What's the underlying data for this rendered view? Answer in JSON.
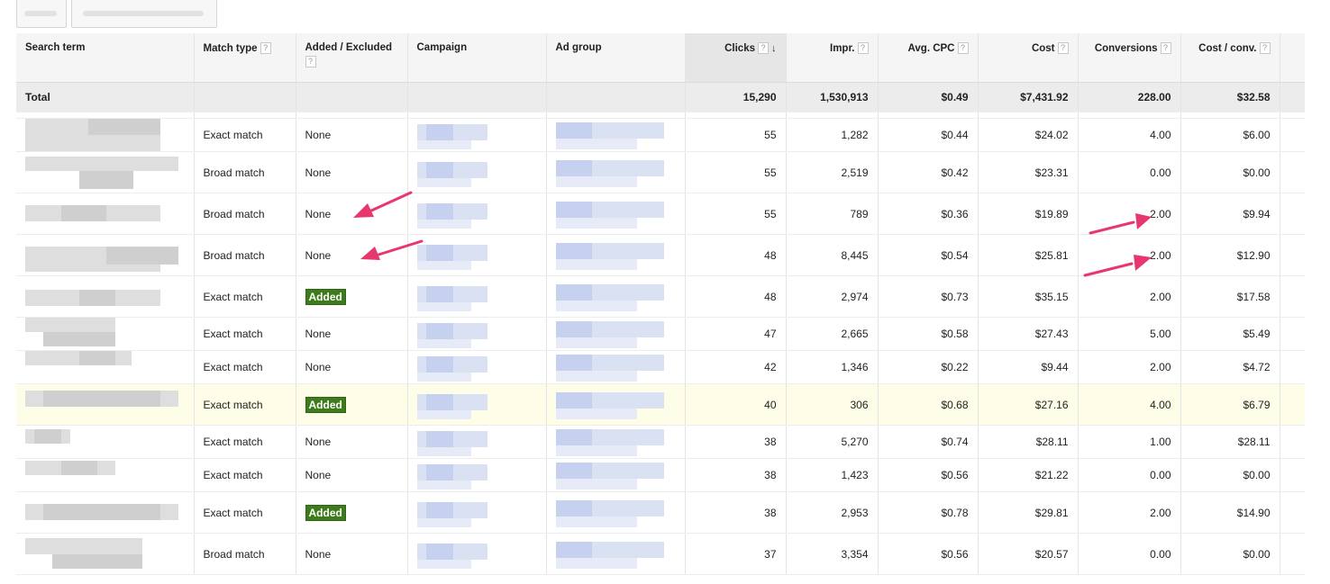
{
  "toolbar": {
    "buttons": [
      {
        "label": ""
      },
      {
        "label": ""
      }
    ]
  },
  "columns": {
    "search_term": "Search term",
    "match_type": "Match type",
    "added_excluded": "Added / Excluded",
    "campaign": "Campaign",
    "ad_group": "Ad group",
    "clicks": "Clicks",
    "impr": "Impr.",
    "avg_cpc": "Avg. CPC",
    "cost": "Cost",
    "conversions": "Conversions",
    "cost_conv": "Cost / conv.",
    "help_glyph": "?",
    "sort_glyph": "↓"
  },
  "total": {
    "label": "Total",
    "clicks": "15,290",
    "impr": "1,530,913",
    "avg_cpc": "$0.49",
    "cost": "$7,431.92",
    "conversions": "228.00",
    "cost_conv": "$32.58"
  },
  "rows": [
    {
      "match_type": "Exact match",
      "status": "None",
      "clicks": "55",
      "impr": "1,282",
      "avg_cpc": "$0.44",
      "cost": "$24.02",
      "conversions": "4.00",
      "cost_conv": "$6.00"
    },
    {
      "match_type": "Broad match",
      "status": "None",
      "clicks": "55",
      "impr": "2,519",
      "avg_cpc": "$0.42",
      "cost": "$23.31",
      "conversions": "0.00",
      "cost_conv": "$0.00"
    },
    {
      "match_type": "Broad match",
      "status": "None",
      "clicks": "55",
      "impr": "789",
      "avg_cpc": "$0.36",
      "cost": "$19.89",
      "conversions": "2.00",
      "cost_conv": "$9.94"
    },
    {
      "match_type": "Broad match",
      "status": "None",
      "clicks": "48",
      "impr": "8,445",
      "avg_cpc": "$0.54",
      "cost": "$25.81",
      "conversions": "2.00",
      "cost_conv": "$12.90"
    },
    {
      "match_type": "Exact match",
      "status": "Added",
      "clicks": "48",
      "impr": "2,974",
      "avg_cpc": "$0.73",
      "cost": "$35.15",
      "conversions": "2.00",
      "cost_conv": "$17.58"
    },
    {
      "match_type": "Exact match",
      "status": "None",
      "clicks": "47",
      "impr": "2,665",
      "avg_cpc": "$0.58",
      "cost": "$27.43",
      "conversions": "5.00",
      "cost_conv": "$5.49"
    },
    {
      "match_type": "Exact match",
      "status": "None",
      "clicks": "42",
      "impr": "1,346",
      "avg_cpc": "$0.22",
      "cost": "$9.44",
      "conversions": "2.00",
      "cost_conv": "$4.72"
    },
    {
      "match_type": "Exact match",
      "status": "Added",
      "clicks": "40",
      "impr": "306",
      "avg_cpc": "$0.68",
      "cost": "$27.16",
      "conversions": "4.00",
      "cost_conv": "$6.79"
    },
    {
      "match_type": "Exact match",
      "status": "None",
      "clicks": "38",
      "impr": "5,270",
      "avg_cpc": "$0.74",
      "cost": "$28.11",
      "conversions": "1.00",
      "cost_conv": "$28.11"
    },
    {
      "match_type": "Exact match",
      "status": "None",
      "clicks": "38",
      "impr": "1,423",
      "avg_cpc": "$0.56",
      "cost": "$21.22",
      "conversions": "0.00",
      "cost_conv": "$0.00"
    },
    {
      "match_type": "Exact match",
      "status": "Added",
      "clicks": "38",
      "impr": "2,953",
      "avg_cpc": "$0.78",
      "cost": "$29.81",
      "conversions": "2.00",
      "cost_conv": "$14.90"
    },
    {
      "match_type": "Broad match",
      "status": "None",
      "clicks": "37",
      "impr": "3,354",
      "avg_cpc": "$0.56",
      "cost": "$20.57",
      "conversions": "0.00",
      "cost_conv": "$0.00"
    }
  ],
  "colors": {
    "added_badge": "#3d7b1b",
    "annotation_arrow": "#e8366e",
    "highlight_row": "#fdfde8",
    "link_blue": "#5a7dd6"
  }
}
